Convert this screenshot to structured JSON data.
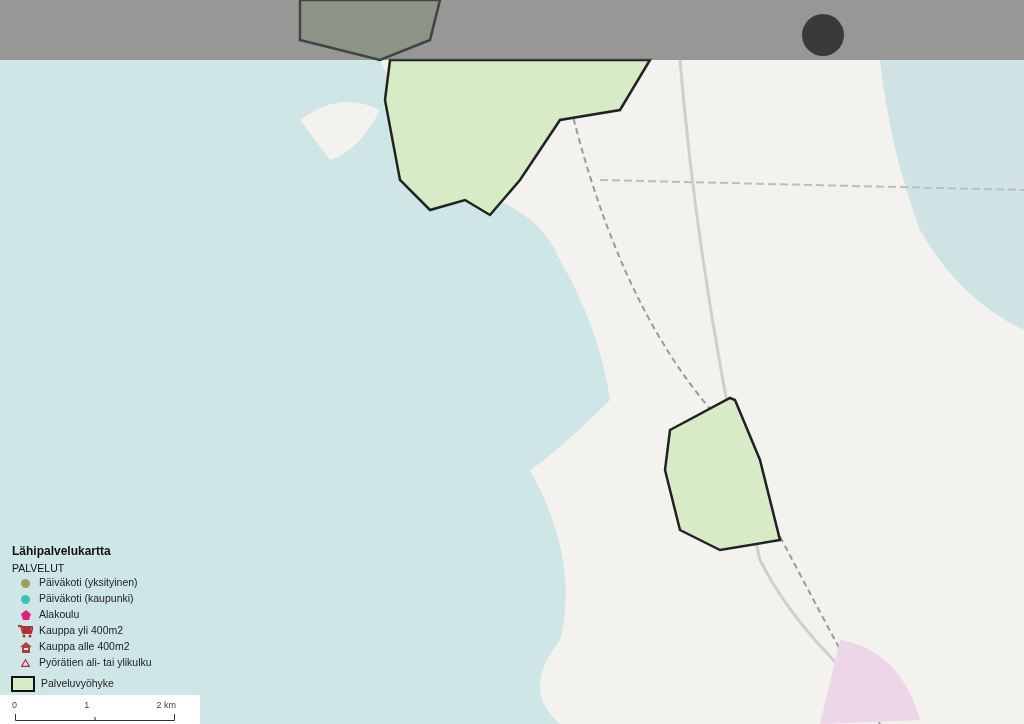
{
  "legend": {
    "title": "Lähipalvelukartta",
    "group": "PALVELUT",
    "items": [
      {
        "label": "Päiväkoti (yksityinen)",
        "kind": "dot",
        "color": "#a39d5c"
      },
      {
        "label": "Päiväkoti (kaupunki)",
        "kind": "dot",
        "color": "#3cbfbb"
      },
      {
        "label": "Alakoulu",
        "kind": "pentagon",
        "color": "#e0207f"
      },
      {
        "label": "Kauppa yli 400m2",
        "kind": "cart",
        "color": "#b0303a"
      },
      {
        "label": "Kauppa alle 400m2",
        "kind": "house",
        "color": "#a8443c"
      },
      {
        "label": "Pyörätien ali- tai ylikulku",
        "kind": "triangle",
        "color": "#c21f4f"
      },
      {
        "label": "Palveluvyöhyke",
        "kind": "area",
        "color": "#d6ebc6"
      }
    ]
  },
  "scale_bar": {
    "ticks": [
      "0",
      "1",
      "2 km"
    ]
  }
}
